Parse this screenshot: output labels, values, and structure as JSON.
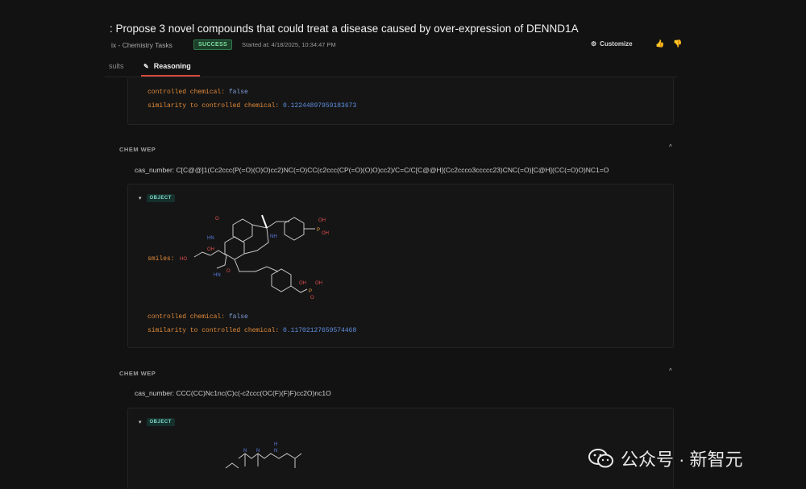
{
  "header": {
    "title": ": Propose 3 novel compounds that could treat a disease caused by over-expression of DENND1A",
    "breadcrumb": "ix - Chemistry Tasks",
    "status_badge": "SUCCESS",
    "started": "Started at: 4/18/2025, 10:34:47 PM",
    "customize_label": "Customize"
  },
  "tabs": {
    "results_label": "sults",
    "reasoning_label": "Reasoning"
  },
  "prev_card": {
    "controlled_key": "controlled chemical:",
    "controlled_val": "false",
    "similarity_key": "similarity to controlled chemical:",
    "similarity_val": "0.12244897959183673"
  },
  "section1": {
    "title": "CHEM WEP",
    "cas": "cas_number: C[C@@]1(Cc2ccc(P(=O)(O)O)cc2)NC(=O)CC(c2ccc(CP(=O)(O)O)cc2)/C=C/C[C@@H](Cc2ccco3ccccc23)CNC(=O)[C@H](CC(=O)O)NC1=O",
    "object_badge": "OBJECT",
    "smiles_key": "smiles:",
    "controlled_key": "controlled chemical:",
    "controlled_val": "false",
    "similarity_key": "similarity to controlled chemical:",
    "similarity_val": "0.11702127659574468",
    "mol_labels": {
      "o1": "O",
      "hn": "HN",
      "ho": "HO",
      "oh": "OH",
      "o2": "O",
      "hn2": "HN",
      "nh": "NH",
      "p1": "P",
      "oh2": "OH",
      "oh3": "OH",
      "p2": "P",
      "oh4": "OH",
      "oh5": "OH",
      "o3": "O"
    }
  },
  "section2": {
    "title": "CHEM WEP",
    "cas": "cas_number: CCC(CC)Nc1nc(C)c(-c2ccc(OC(F)(F)F)cc2O)nc1O",
    "object_badge": "OBJECT",
    "mol_labels": {
      "h": "H",
      "n1": "N",
      "n2": "N",
      "n3": "N"
    }
  },
  "watermark": {
    "text": "公众号 · 新智元"
  }
}
